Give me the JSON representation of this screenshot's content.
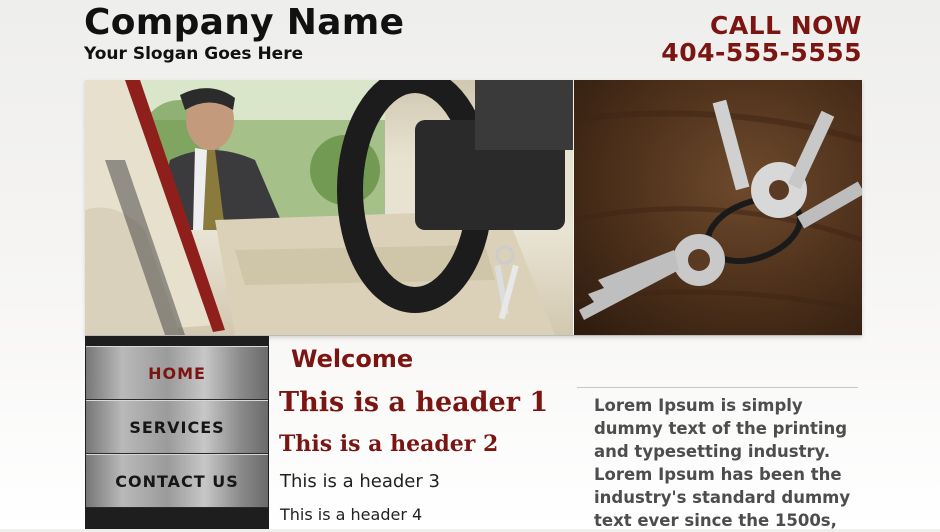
{
  "header": {
    "company_name": "Company Name",
    "slogan": "Your Slogan Goes Here",
    "call_label": "CALL NOW",
    "phone": "404-555-5555"
  },
  "nav": {
    "items": [
      {
        "label": "HOME",
        "active": true
      },
      {
        "label": "SERVICES",
        "active": false
      },
      {
        "label": "CONTACT US",
        "active": false
      }
    ]
  },
  "content": {
    "welcome": "Welcome",
    "header1": "This is a header 1",
    "header2": "This is a header 2",
    "header3": "This is a header 3",
    "header4": "This is a header 4",
    "lorem": "Lorem Ipsum is simply dummy text of the printing and typesetting industry. Lorem Ipsum has been the industry's standard dummy text ever since the 1500s,"
  },
  "colors": {
    "accent": "#7a1512",
    "text_dark": "#111111",
    "body_text": "#4d4d4d",
    "nav_bg": "#1e1e1e"
  }
}
